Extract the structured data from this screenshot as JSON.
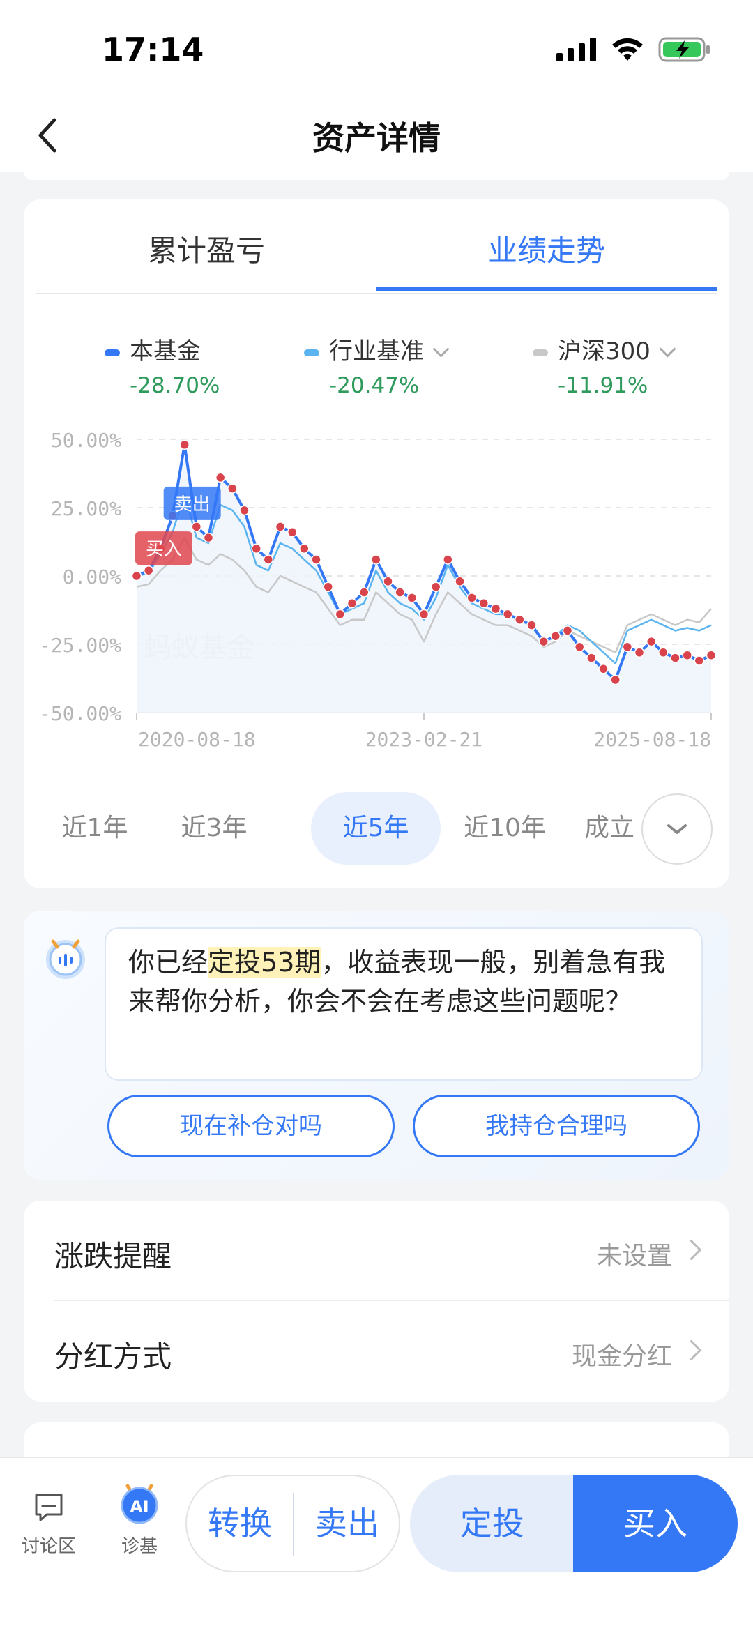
{
  "status": {
    "time": "17:14"
  },
  "nav": {
    "title": "资产详情"
  },
  "tabs": [
    {
      "label": "累计盈亏",
      "active": false
    },
    {
      "label": "业绩走势",
      "active": true
    }
  ],
  "legend": [
    {
      "name": "本基金",
      "value": "-28.70%",
      "color": "#3478f6",
      "dropdown": false
    },
    {
      "name": "行业基准",
      "value": "-20.47%",
      "color": "#5ab4ef",
      "dropdown": true
    },
    {
      "name": "沪深300",
      "value": "-11.91%",
      "color": "#c8c8c8",
      "dropdown": true
    }
  ],
  "chart_data": {
    "type": "line",
    "y_tick_labels": [
      "50.00%",
      "25.00%",
      "0.00%",
      "-25.00%",
      "-50.00%"
    ],
    "ylim": [
      -50,
      50
    ],
    "x_tick_labels": [
      "2020-08-18",
      "2023-02-21",
      "2025-08-18"
    ],
    "watermark": "蚂蚁基金",
    "markers": {
      "buy": "买入",
      "sell": "卖出"
    },
    "series": [
      {
        "name": "本基金",
        "color": "#3478f6",
        "values": [
          0,
          2,
          10,
          22,
          48,
          18,
          14,
          36,
          32,
          24,
          10,
          6,
          18,
          16,
          10,
          6,
          -4,
          -14,
          -10,
          -6,
          6,
          -2,
          -6,
          -8,
          -14,
          -4,
          6,
          -2,
          -8,
          -10,
          -12,
          -14,
          -16,
          -18,
          -24,
          -22,
          -20,
          -26,
          -30,
          -34,
          -38,
          -26,
          -28,
          -24,
          -28,
          -30,
          -29,
          -31,
          -29
        ]
      },
      {
        "name": "行业基准",
        "color": "#5ab4ef",
        "values": [
          0,
          1,
          8,
          16,
          30,
          14,
          12,
          26,
          24,
          18,
          4,
          2,
          12,
          10,
          6,
          2,
          -6,
          -14,
          -12,
          -10,
          2,
          -6,
          -10,
          -12,
          -16,
          -8,
          4,
          -4,
          -10,
          -12,
          -14,
          -14,
          -16,
          -18,
          -24,
          -22,
          -18,
          -20,
          -24,
          -28,
          -32,
          -20,
          -18,
          -16,
          -18,
          -20,
          -19,
          -20,
          -18
        ]
      },
      {
        "name": "沪深300",
        "color": "#c8c8c8",
        "values": [
          -4,
          -3,
          2,
          6,
          14,
          6,
          4,
          8,
          6,
          2,
          -4,
          -6,
          0,
          -2,
          -4,
          -6,
          -12,
          -18,
          -16,
          -16,
          -6,
          -10,
          -14,
          -16,
          -24,
          -14,
          -6,
          -10,
          -14,
          -16,
          -18,
          -18,
          -20,
          -22,
          -26,
          -24,
          -20,
          -22,
          -24,
          -26,
          -28,
          -18,
          -16,
          -14,
          -16,
          -18,
          -16,
          -17,
          -12
        ]
      }
    ]
  },
  "ranges": [
    {
      "label": "近1年",
      "active": false
    },
    {
      "label": "近3年",
      "active": false
    },
    {
      "label": "近5年",
      "active": true
    },
    {
      "label": "近10年",
      "active": false
    },
    {
      "label": "成立",
      "active": false
    }
  ],
  "ai": {
    "text_before": "你已经",
    "highlight": "定投53期",
    "text_after": "，收益表现一般，别着急有我来帮你分析，你会不会在考虑这些问题呢？",
    "buttons": [
      "现在补仓对吗",
      "我持仓合理吗"
    ]
  },
  "settings": [
    {
      "label": "涨跌提醒",
      "value": "未设置"
    },
    {
      "label": "分红方式",
      "value": "现金分红"
    }
  ],
  "bottombar": {
    "discuss_label": "讨论区",
    "diagnose_label": "诊基",
    "convert": "转换",
    "sell": "卖出",
    "invest": "定投",
    "buy": "买入"
  }
}
